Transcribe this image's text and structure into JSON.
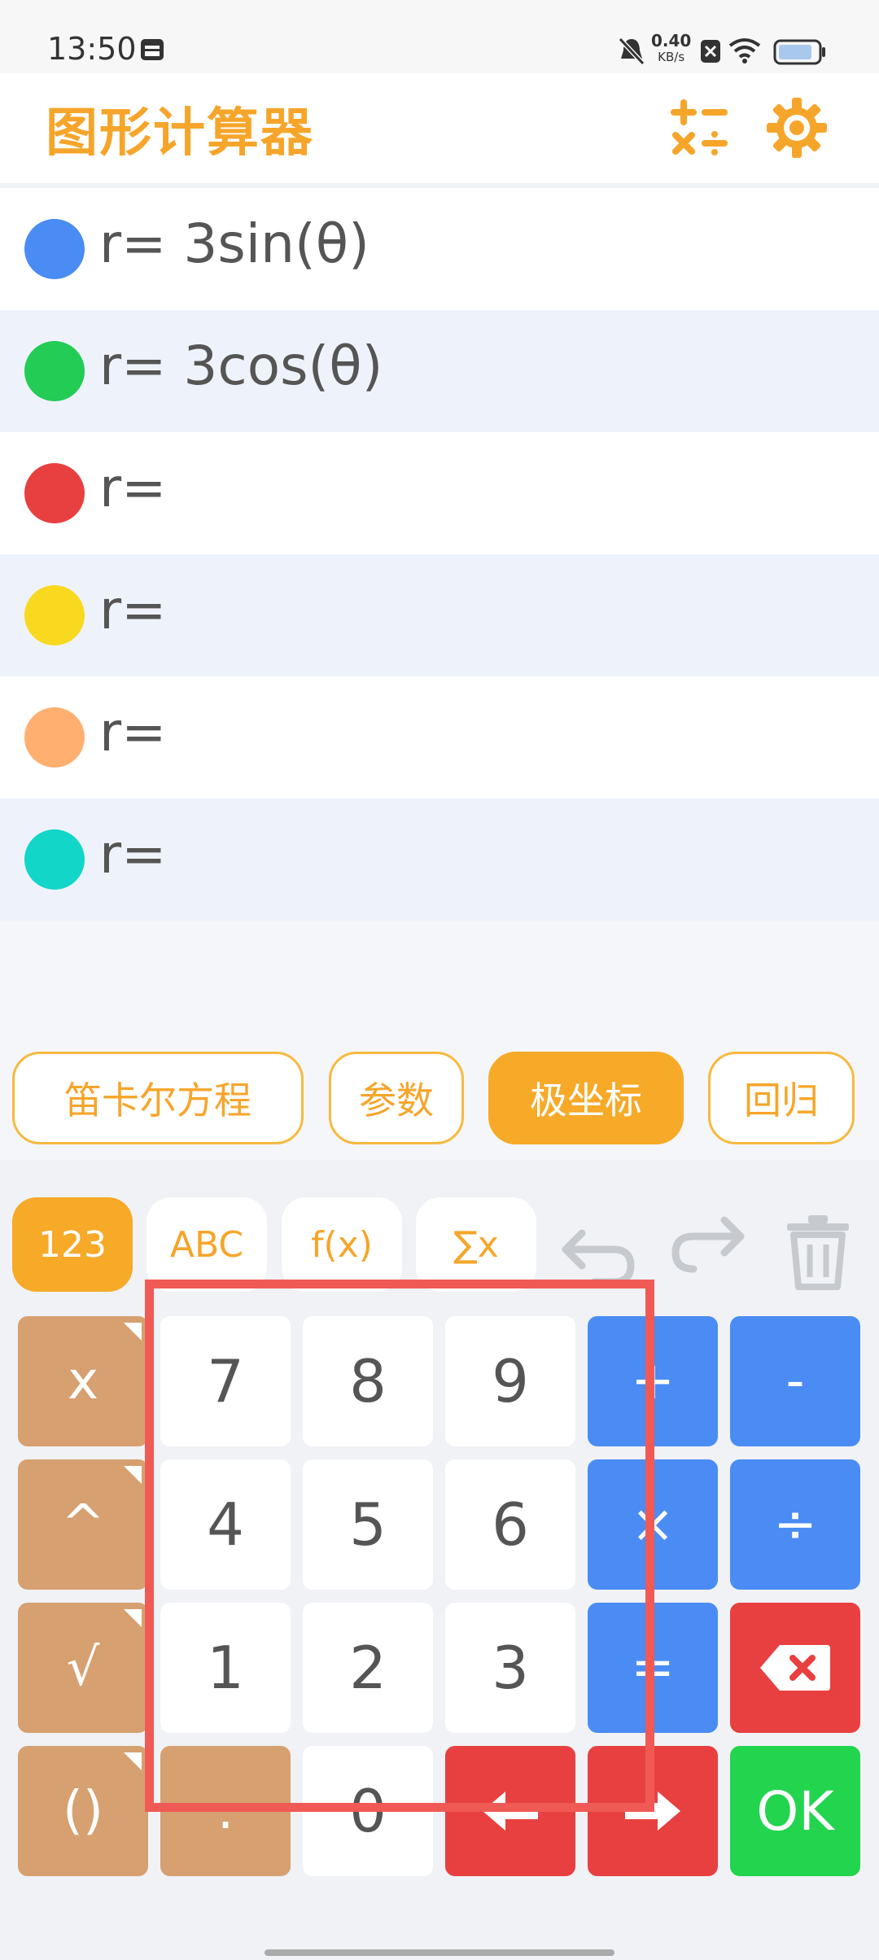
{
  "status": {
    "time": "13:50",
    "net_speed": "0.40",
    "net_unit": "KB/s"
  },
  "app": {
    "title": "图形计算器"
  },
  "equations": [
    {
      "label": "r=",
      "expr": "3sin(θ)",
      "color": "#4a8cf4"
    },
    {
      "label": "r=",
      "expr": "3cos(θ)",
      "color": "#22cc55"
    },
    {
      "label": "r=",
      "expr": "",
      "color": "#e84040"
    },
    {
      "label": "r=",
      "expr": "",
      "color": "#f9d91f"
    },
    {
      "label": "r=",
      "expr": "",
      "color": "#ffb070"
    },
    {
      "label": "r=",
      "expr": "",
      "color": "#12d6c8"
    }
  ],
  "modes": [
    "笛卡尔方程",
    "参数",
    "极坐标",
    "回归"
  ],
  "active_mode": "极坐标",
  "keyboard": {
    "tabs": [
      "123",
      "ABC",
      "f(x)",
      "∑x"
    ],
    "active_tab": "123",
    "fn_keys": [
      "x",
      "^",
      "√",
      "()"
    ],
    "dot_key": ".",
    "digits": {
      "d7": "7",
      "d8": "8",
      "d9": "9",
      "d4": "4",
      "d5": "5",
      "d6": "6",
      "d1": "1",
      "d2": "2",
      "d3": "3",
      "d0": "0"
    },
    "ops": {
      "plus": "+",
      "minus": "-",
      "times": "×",
      "divide": "÷",
      "equals": "="
    },
    "ok": "OK"
  }
}
